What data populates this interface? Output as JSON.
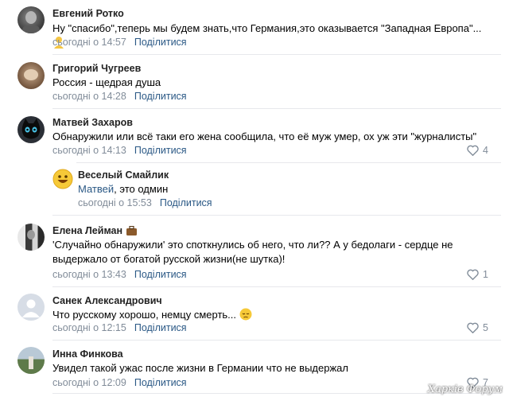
{
  "comments": [
    {
      "author": "Евгений Ротко",
      "text": "Ну \"спасибо\",теперь мы будем знать,что Германия,это оказывается \"Западная Европа\"...",
      "time": "сьогодні о 14:57",
      "share": "Поділитися",
      "avatar_icon": "photo-avatar-gray"
    },
    {
      "author": "Григорий Чугреев",
      "text": "Россия - щедрая душа",
      "time": "сьогодні о 14:28",
      "share": "Поділитися",
      "avatar_icon": "photo-avatar-brown"
    },
    {
      "author": "Матвей Захаров",
      "text": "Обнаружили или всё таки его жена сообщила, что её муж умер, ох уж эти \"журналисты\"",
      "time": "сьогодні о 14:13",
      "share": "Поділитися",
      "likes": "4",
      "avatar_icon": "black-cat-avatar",
      "reply": {
        "author": "Веселый Смайлик",
        "mention": "Матвей",
        "text": ", это одмин",
        "time": "сьогодні о 15:53",
        "share": "Поділитися",
        "avatar_icon": "smiley-avatar"
      }
    },
    {
      "author": "Елена Лейман",
      "text": "'Случайно обнаружили' это споткнулись об него, что ли?? А у бедолаги - сердце не выдержало от богатой русской жизни(не шутка)!",
      "time": "сьогодні о 13:43",
      "share": "Поділитися",
      "likes": "1",
      "avatar_icon": "photo-avatar-dark"
    },
    {
      "author": "Санек Александрович",
      "text": "Что русскому хорошо, немцу смерть...",
      "time": "сьогодні о 12:15",
      "share": "Поділитися",
      "likes": "5",
      "avatar_icon": "default-user-avatar"
    },
    {
      "author": "Инна Финкова",
      "text": "Увидел такой ужас после жизни в Германии что не выдержал",
      "time": "сьогодні о 12:09",
      "share": "Поділитися",
      "likes": "7",
      "avatar_icon": "photo-avatar-green"
    }
  ],
  "watermark": "Харків Форум",
  "colors": {
    "link": "#2a5885",
    "meta": "#818c99",
    "separator": "#e7e8ec"
  }
}
